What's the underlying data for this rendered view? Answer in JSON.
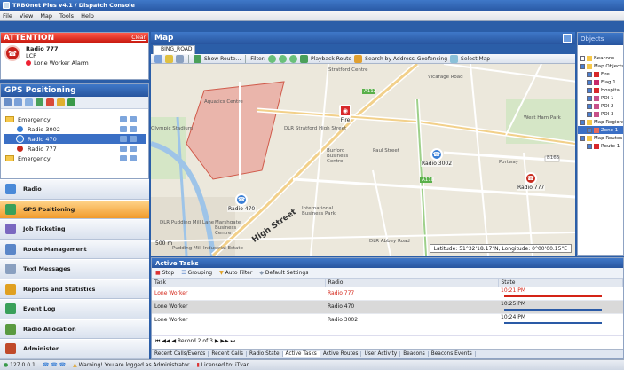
{
  "window": {
    "title": "TRBOnet Plus v4.1 / Dispatch Console"
  },
  "menu": [
    "File",
    "View",
    "Map",
    "Tools",
    "Help"
  ],
  "attention": {
    "title": "ATTENTION",
    "clear": "Clear",
    "alarm": {
      "name": "Radio 777",
      "mode": "LCP",
      "type": "Lone Worker Alarm"
    }
  },
  "gps": {
    "title": "GPS Positioning",
    "tree": [
      {
        "label": "Emergency",
        "kind": "folder"
      },
      {
        "label": "Radio 3002",
        "kind": "radio",
        "color": "#3a7fd5"
      },
      {
        "label": "Radio 470",
        "kind": "radio",
        "color": "#3a7fd5",
        "selected": true
      },
      {
        "label": "Radio 777",
        "kind": "radio",
        "color": "#c82a1c"
      },
      {
        "label": "Emergency",
        "kind": "folder"
      }
    ]
  },
  "nav": [
    {
      "label": "Radio",
      "color": "#4a8ad8"
    },
    {
      "label": "GPS Positioning",
      "color": "#3aa05a",
      "active": true
    },
    {
      "label": "Job Ticketing",
      "color": "#7a68c0"
    },
    {
      "label": "Route Management",
      "color": "#5a86c8"
    },
    {
      "label": "Text Messages",
      "color": "#8aa0c0"
    },
    {
      "label": "Reports and Statistics",
      "color": "#e0a020"
    },
    {
      "label": "Event Log",
      "color": "#3aa05a"
    },
    {
      "label": "Radio Allocation",
      "color": "#5a9a40"
    },
    {
      "label": "Administer",
      "color": "#c04a2a"
    }
  ],
  "map": {
    "title": "Map",
    "tab": "BING_ROAD",
    "toolbar": [
      "Show Route...",
      "Filter:",
      "Playback Route",
      "Search by Address",
      "Geofencing",
      "Select Map"
    ],
    "scale": "500 m",
    "coords": "Latitude: 51°32'18.17\"N, Longitude: 0°00'00.15\"E",
    "markers": [
      {
        "label": "Fire",
        "color": "#d8282a",
        "glyph": "◉"
      },
      {
        "label": "Radio 3002",
        "color": "#3a7fd5",
        "glyph": "☎"
      },
      {
        "label": "Radio 470",
        "color": "#3a7fd5",
        "glyph": "☎"
      },
      {
        "label": "Radio 777",
        "color": "#c82a1c",
        "glyph": "☎"
      }
    ],
    "labels": [
      "Stratford Centre",
      "West Ham Park",
      "Aquatics Centre",
      "Olympic Stadium",
      "DLR Stratford High Street",
      "Burford Business Centre",
      "International Business Park",
      "DLR Pudding Mill Lane",
      "Marshgate Business Centre",
      "DLR Abbey Road",
      "Pudding Mill Industrial Estate",
      "High Street",
      "Portway",
      "Vicarage Road",
      "Paul Street",
      "B165",
      "A112",
      "A118"
    ]
  },
  "tasks": {
    "title": "Active Tasks",
    "toolbar": [
      "Stop",
      "Grouping",
      "Auto Filter",
      "Default Settings"
    ],
    "columns": [
      "Task",
      "Radio",
      "State"
    ],
    "rows": [
      {
        "task": "Lone Worker",
        "radio": "Radio 777",
        "state": "10:21 PM",
        "alarm": true,
        "bar": "#d42417"
      },
      {
        "task": "Lone Worker",
        "radio": "Radio 470",
        "state": "10:25 PM",
        "selected": true,
        "bar": "#2a5aa6"
      },
      {
        "task": "Lone Worker",
        "radio": "Radio 3002",
        "state": "10:24 PM",
        "bar": "#2a5aa6"
      }
    ],
    "pager": "Record 2 of 3",
    "tabs": [
      "Recent Calls/Events",
      "Recent Calls",
      "Radio State",
      "Active Tasks",
      "Active Routes",
      "User Activity",
      "Beacons",
      "Beacons Events"
    ],
    "active_tab": "Active Tasks"
  },
  "objects": {
    "title": "Objects",
    "items": [
      {
        "label": "Beacons",
        "indent": 0,
        "icon": "#f6c84a",
        "checked": false
      },
      {
        "label": "Map Objects",
        "indent": 0,
        "icon": "#f6c84a",
        "checked": true
      },
      {
        "label": "Fire",
        "indent": 1,
        "icon": "#d8282a",
        "checked": true
      },
      {
        "label": "Flag 1",
        "indent": 1,
        "icon": "#c82a6a",
        "checked": true
      },
      {
        "label": "Hospital",
        "indent": 1,
        "icon": "#d8282a",
        "checked": true
      },
      {
        "label": "POI 1",
        "indent": 1,
        "icon": "#c8508a",
        "checked": true
      },
      {
        "label": "POI 2",
        "indent": 1,
        "icon": "#c8508a",
        "checked": true
      },
      {
        "label": "POI 3",
        "indent": 1,
        "icon": "#c8508a",
        "checked": true
      },
      {
        "label": "Map Regions",
        "indent": 0,
        "icon": "#f6c84a",
        "checked": true
      },
      {
        "label": "Zone 1",
        "indent": 1,
        "icon": "#e86a5a",
        "checked": true,
        "selected": true
      },
      {
        "label": "Map Routes",
        "indent": 0,
        "icon": "#f6c84a",
        "checked": true
      },
      {
        "label": "Route 1",
        "indent": 1,
        "icon": "#d8282a",
        "checked": true
      }
    ]
  },
  "status": {
    "server": "127.0.0.1",
    "warning": "Warning! You are logged as Administrator",
    "license": "Licensed to: iTvan"
  }
}
